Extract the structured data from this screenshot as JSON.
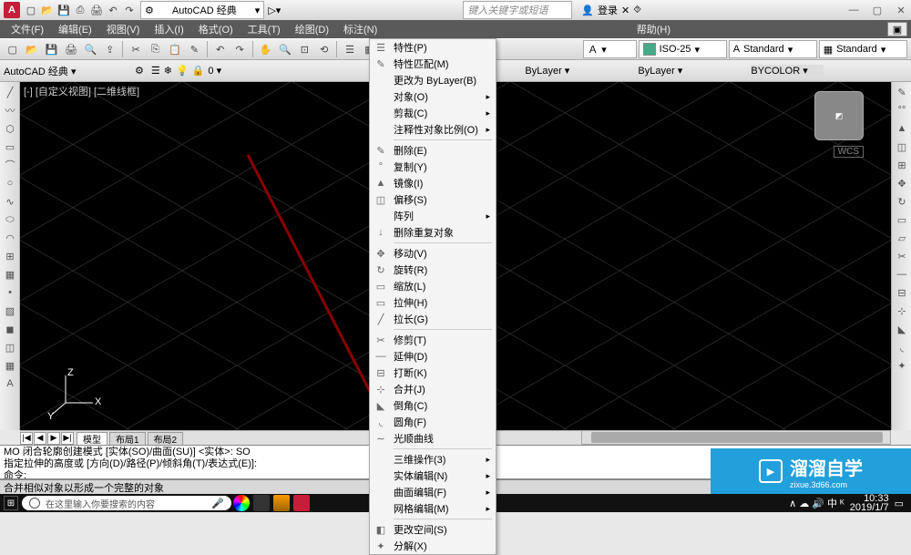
{
  "titlebar": {
    "app_letter": "A",
    "workspace": "AutoCAD 经典",
    "search_placeholder": "键入关键字或短语",
    "login": "登录"
  },
  "menubar": {
    "items": [
      "文件(F)",
      "编辑(E)",
      "视图(V)",
      "插入(I)",
      "格式(O)",
      "工具(T)",
      "绘图(D)",
      "标注(N)"
    ],
    "help": "帮助(H)"
  },
  "toolbar1": {
    "workspace2": "AutoCAD 经典",
    "layer_state": "0"
  },
  "properties": {
    "dim_style": "ISO-25",
    "text_style": "Standard",
    "table_style": "Standard",
    "bylayer1": "ByLayer",
    "bylayer2": "ByLayer",
    "bycolor": "BYCOLOR"
  },
  "view": {
    "label": "[-] [自定义视图] [二维线框]",
    "wcs": "WCS",
    "axes": {
      "x": "X",
      "y": "Y",
      "z": "Z"
    }
  },
  "context_menu": {
    "items": [
      {
        "icon": "☰",
        "label": "特性(P)",
        "sub": false,
        "sep": false
      },
      {
        "icon": "✎",
        "label": "特性匹配(M)",
        "sub": false,
        "sep": false
      },
      {
        "icon": "",
        "label": "更改为 ByLayer(B)",
        "sub": false,
        "sep": false
      },
      {
        "icon": "",
        "label": "对象(O)",
        "sub": true,
        "sep": false
      },
      {
        "icon": "",
        "label": "剪裁(C)",
        "sub": true,
        "sep": false
      },
      {
        "icon": "",
        "label": "注释性对象比例(O)",
        "sub": true,
        "sep": true
      },
      {
        "icon": "✎",
        "label": "删除(E)",
        "sub": false,
        "sep": false
      },
      {
        "icon": "°",
        "label": "复制(Y)",
        "sub": false,
        "sep": false
      },
      {
        "icon": "▲",
        "label": "镜像(I)",
        "sub": false,
        "sep": false
      },
      {
        "icon": "◫",
        "label": "偏移(S)",
        "sub": false,
        "sep": false
      },
      {
        "icon": "",
        "label": "阵列",
        "sub": true,
        "sep": false
      },
      {
        "icon": "↓",
        "label": "删除重复对象",
        "sub": false,
        "sep": true
      },
      {
        "icon": "✥",
        "label": "移动(V)",
        "sub": false,
        "sep": false
      },
      {
        "icon": "↻",
        "label": "旋转(R)",
        "sub": false,
        "sep": false
      },
      {
        "icon": "▭",
        "label": "缩放(L)",
        "sub": false,
        "sep": false
      },
      {
        "icon": "▭",
        "label": "拉伸(H)",
        "sub": false,
        "sep": false
      },
      {
        "icon": "╱",
        "label": "拉长(G)",
        "sub": false,
        "sep": true
      },
      {
        "icon": "✂",
        "label": "修剪(T)",
        "sub": false,
        "sep": false
      },
      {
        "icon": "—",
        "label": "延伸(D)",
        "sub": false,
        "sep": false
      },
      {
        "icon": "⊟",
        "label": "打断(K)",
        "sub": false,
        "sep": false
      },
      {
        "icon": "⊹",
        "label": "合并(J)",
        "sub": false,
        "sep": false
      },
      {
        "icon": "◣",
        "label": "倒角(C)",
        "sub": false,
        "sep": false
      },
      {
        "icon": "◟",
        "label": "圆角(F)",
        "sub": false,
        "sep": false
      },
      {
        "icon": "∼",
        "label": "光顺曲线",
        "sub": false,
        "sep": true
      },
      {
        "icon": "",
        "label": "三维操作(3)",
        "sub": true,
        "sep": false
      },
      {
        "icon": "",
        "label": "实体编辑(N)",
        "sub": true,
        "sep": false
      },
      {
        "icon": "",
        "label": "曲面编辑(F)",
        "sub": true,
        "sep": false
      },
      {
        "icon": "",
        "label": "网格编辑(M)",
        "sub": true,
        "sep": true
      },
      {
        "icon": "◧",
        "label": "更改空间(S)",
        "sub": false,
        "sep": false
      },
      {
        "icon": "✦",
        "label": "分解(X)",
        "sub": false,
        "sep": false
      }
    ]
  },
  "tabs": {
    "nav": [
      "|◀",
      "◀",
      "▶",
      "▶|"
    ],
    "items": [
      "模型",
      "布局1",
      "布局2"
    ]
  },
  "command": {
    "line1": "MO 闭合轮廓创建模式 [实体(SO)/曲面(SU)] <实体>:  SO",
    "line2": "指定拉伸的高度或 [方向(D)/路径(P)/倾斜角(T)/表达式(E)]:",
    "line3": "命令:"
  },
  "statusbar": {
    "hint": "合并相似对象以形成一个完整的对象"
  },
  "taskbar": {
    "search_text": "在这里输入你要搜索的内容",
    "time": "10:33",
    "date": "2019/1/7",
    "tray": "∧ ☁ 🔊 中 ᴷ"
  },
  "watermark": {
    "big": "溜溜自学",
    "small": "zixue.3d66.com"
  }
}
